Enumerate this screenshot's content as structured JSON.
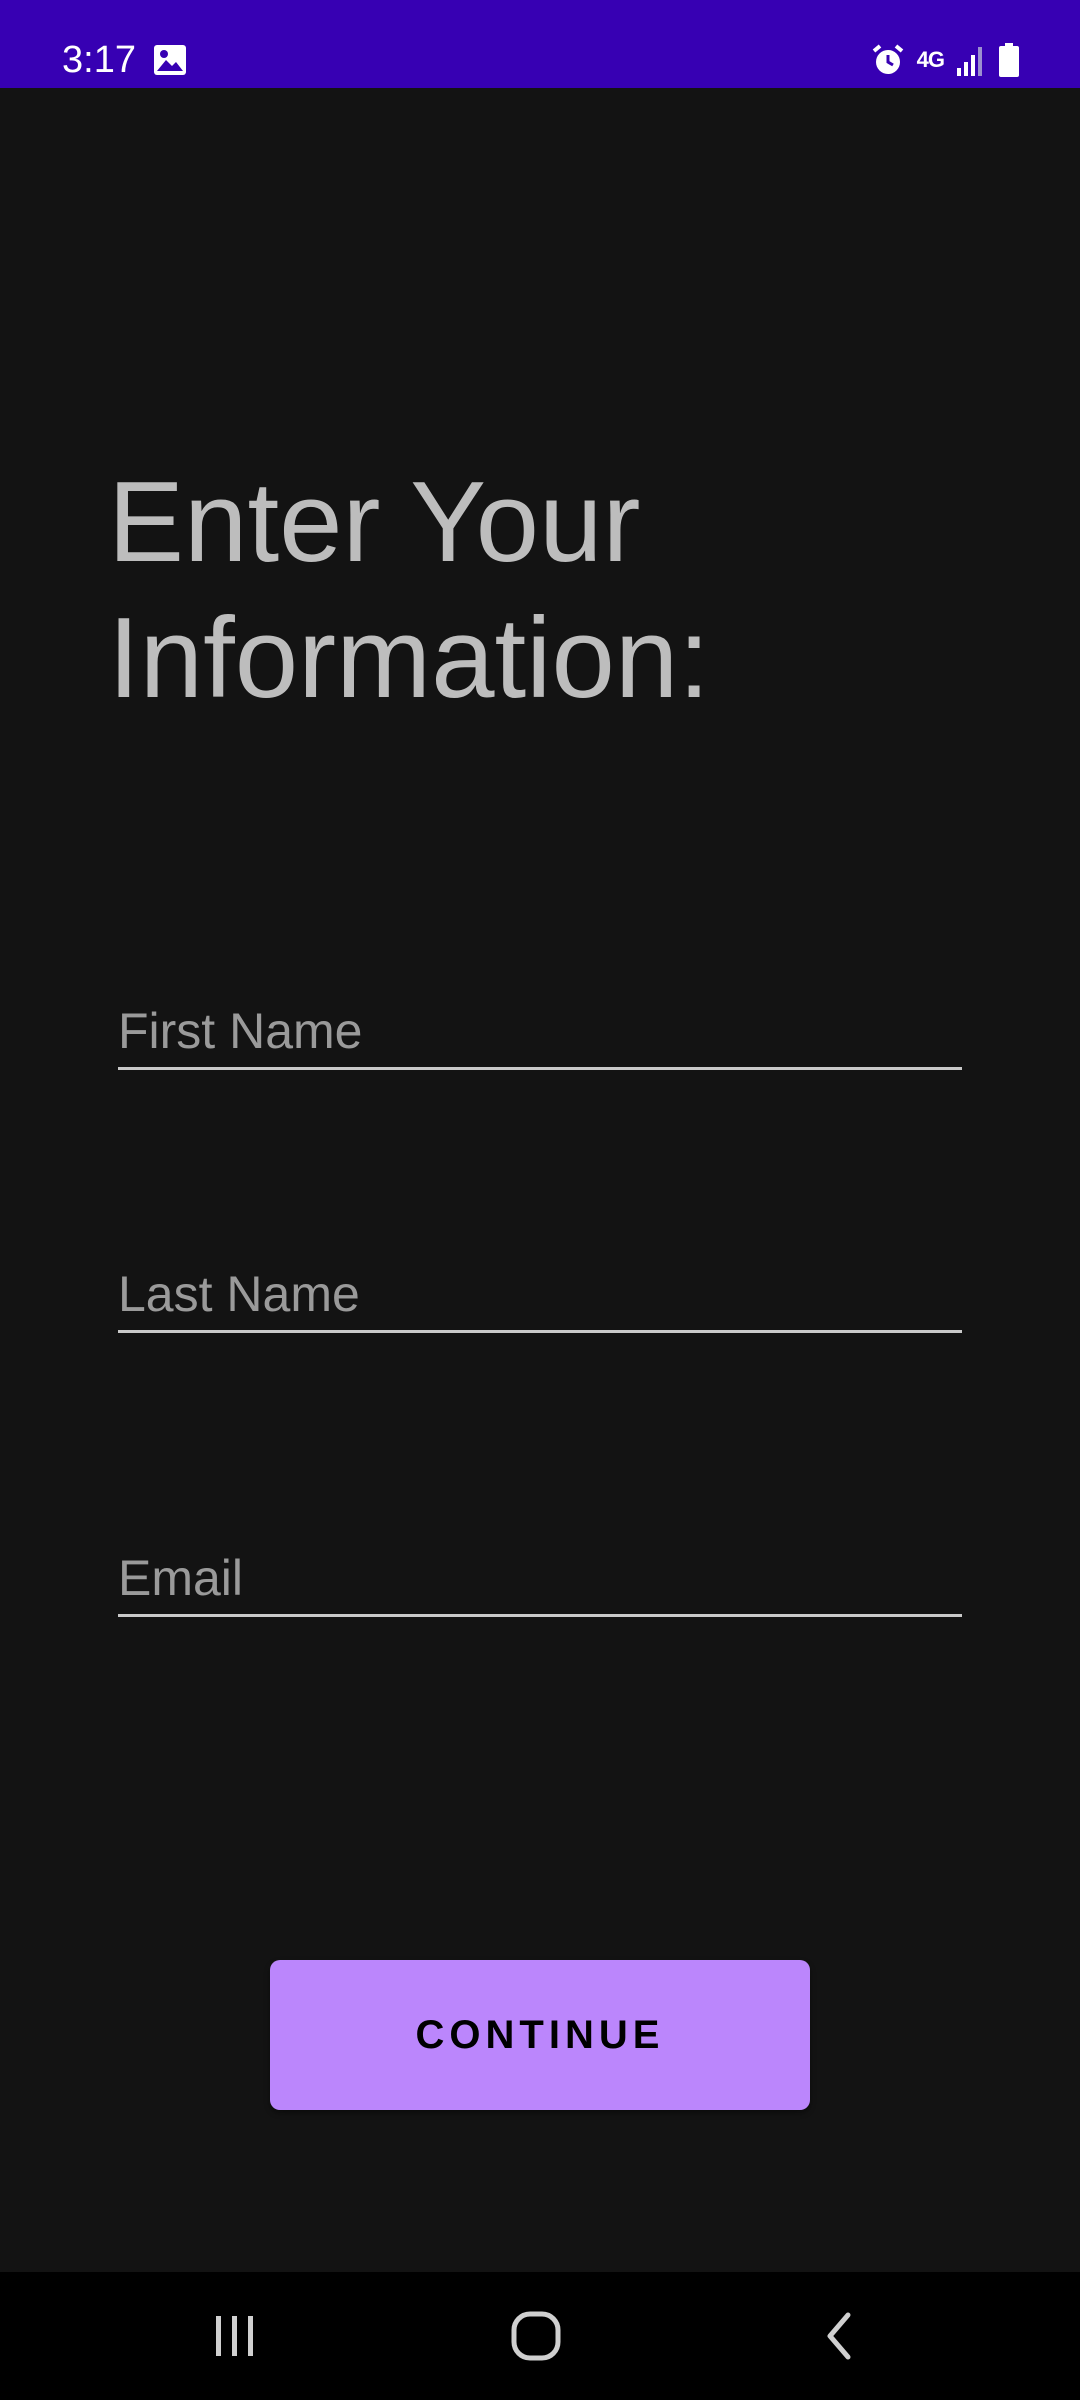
{
  "status_bar": {
    "time": "3:17",
    "network": "4G",
    "background_color": "#3700b3",
    "icons": [
      "gallery-icon",
      "alarm-icon",
      "network-4g-icon",
      "signal-icon",
      "battery-icon"
    ]
  },
  "main": {
    "title": "Enter Your Information:",
    "fields": {
      "first_name": {
        "value": "",
        "placeholder": "First Name"
      },
      "last_name": {
        "value": "",
        "placeholder": "Last Name"
      },
      "email": {
        "value": "",
        "placeholder": "Email"
      }
    },
    "continue_label": "CONTINUE",
    "accent_color": "#bb86fc",
    "background_color": "#131313"
  },
  "nav_bar": {
    "icons": [
      "recents-icon",
      "home-icon",
      "back-icon"
    ]
  }
}
